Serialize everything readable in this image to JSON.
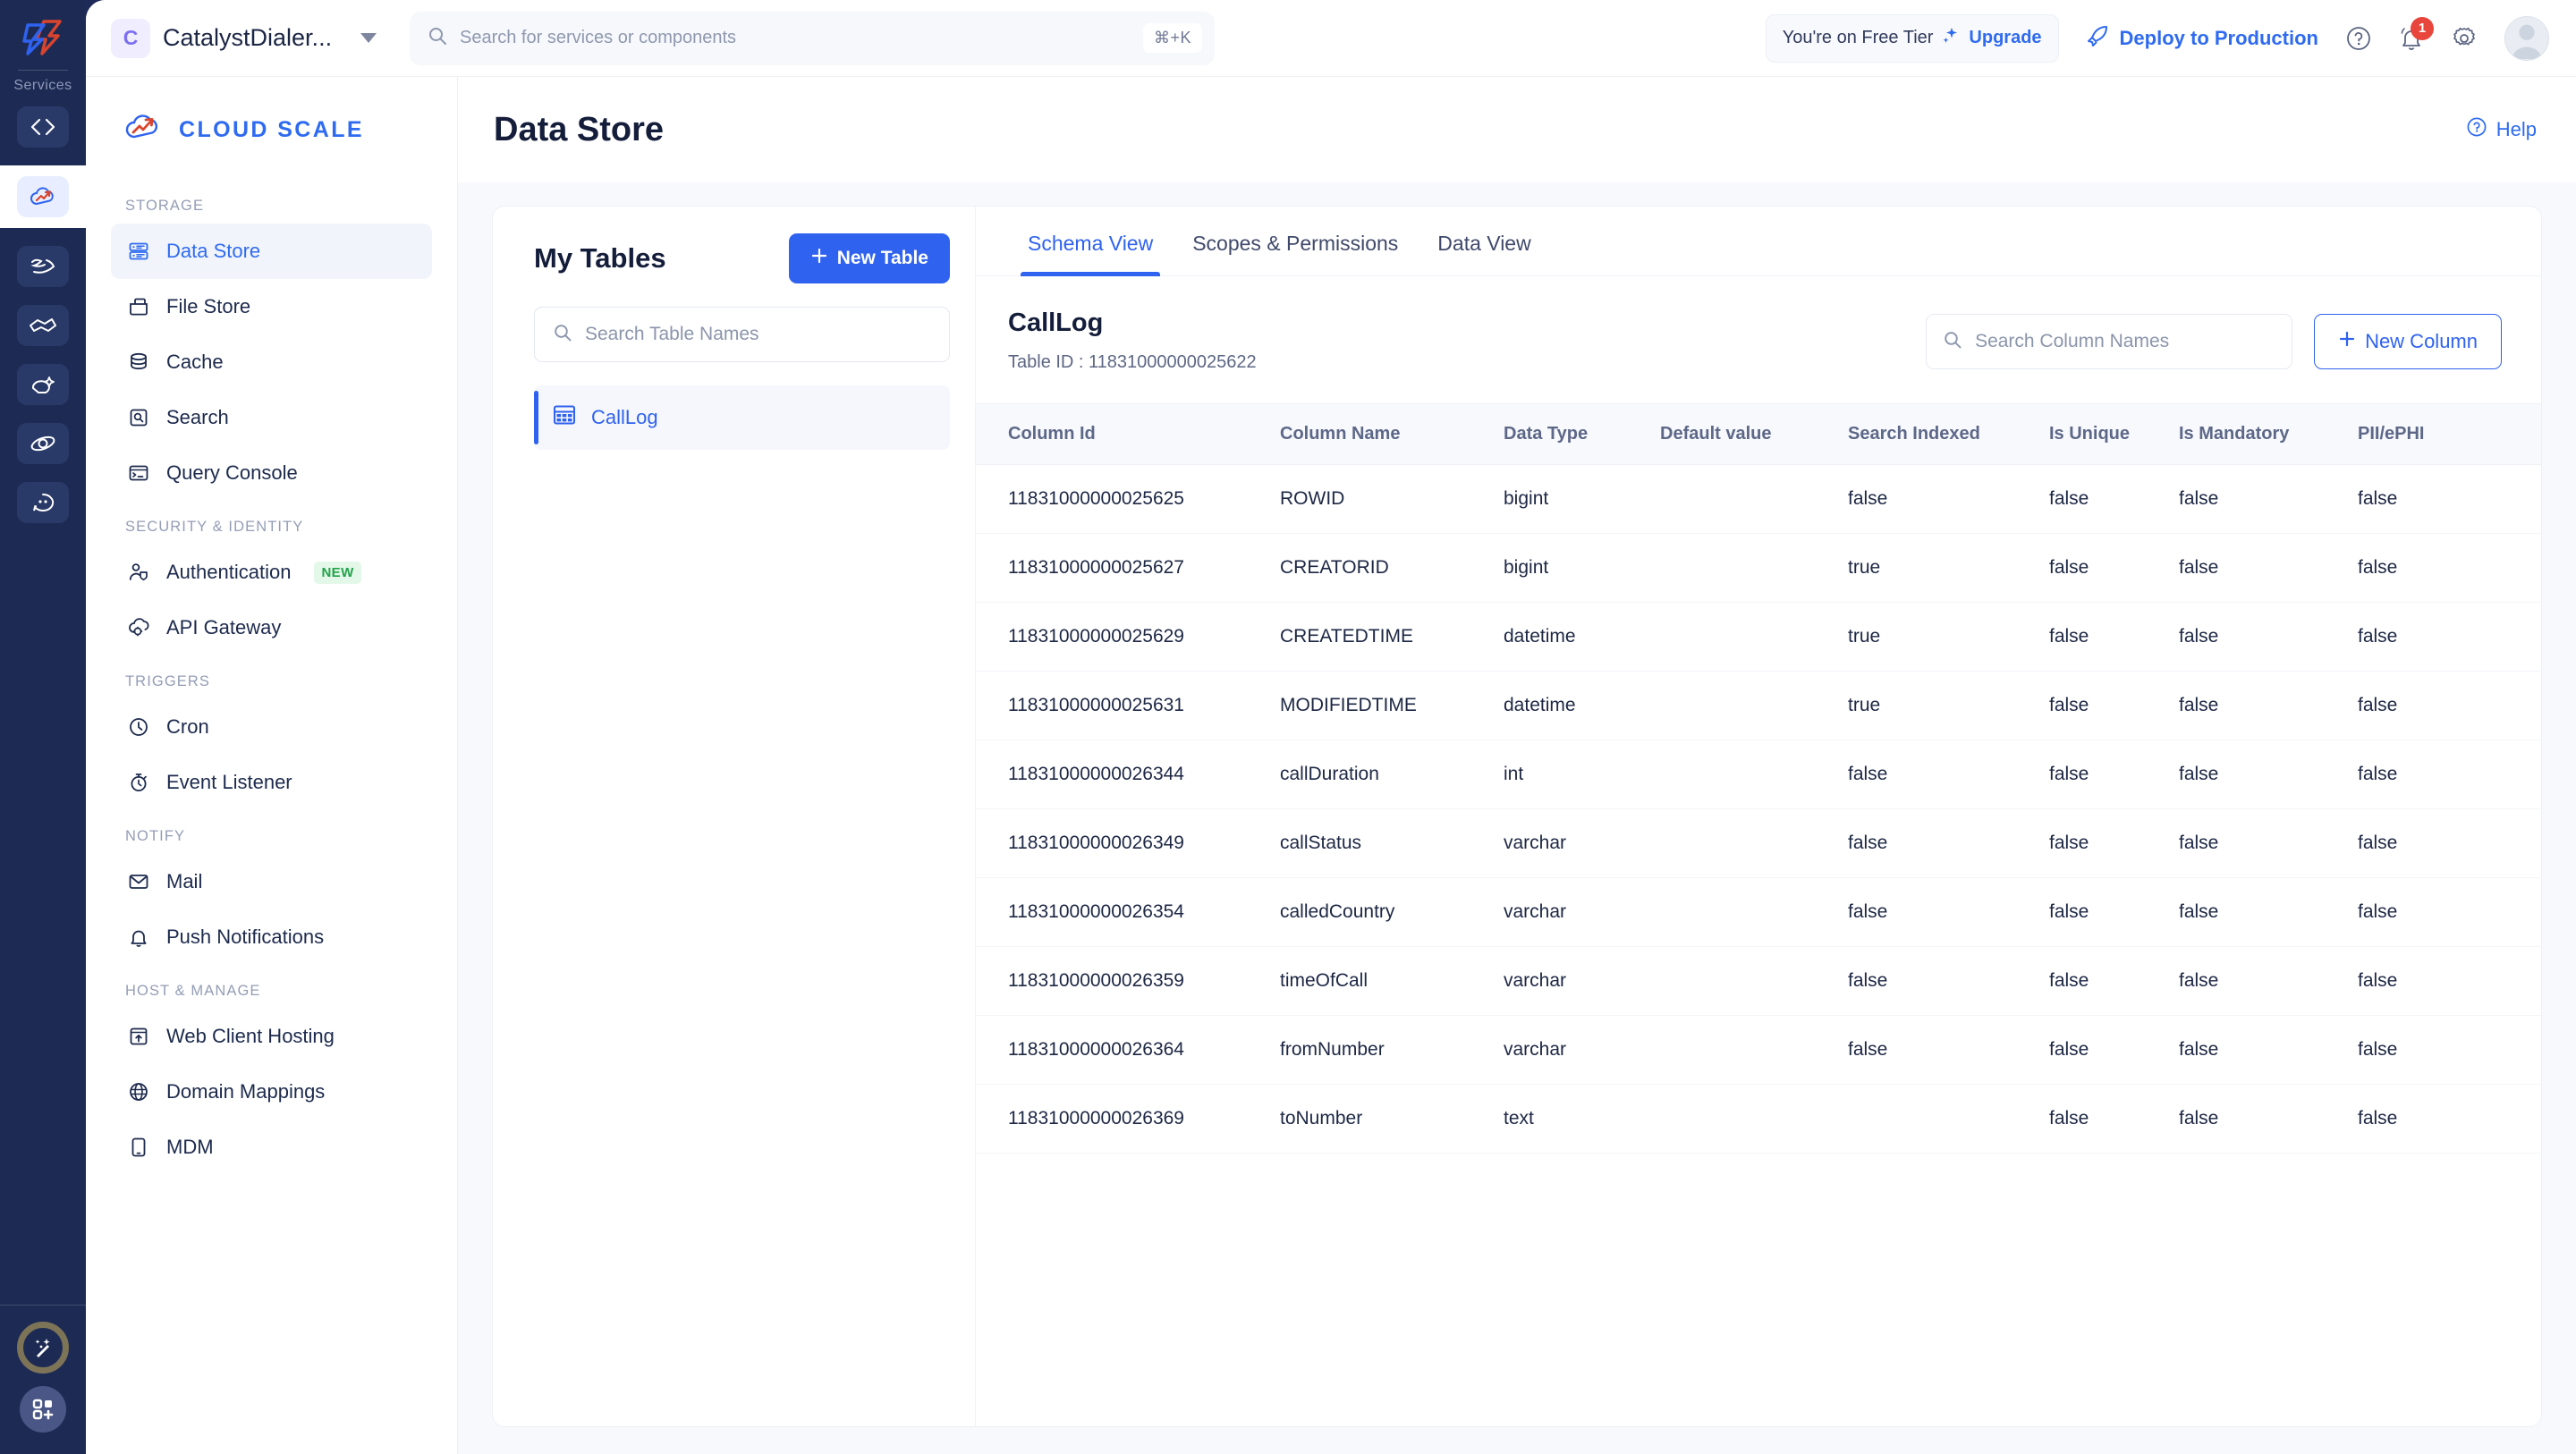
{
  "rail": {
    "logo_icon": "zoho-catalyst-logo-icon",
    "label": "Services",
    "items": [
      {
        "name": "code-icon",
        "active": false
      },
      {
        "name": "cloud-scale-icon",
        "active": true
      },
      {
        "name": "zia-icon",
        "active": false
      },
      {
        "name": "handshake-icon",
        "active": false
      },
      {
        "name": "quickml-icon",
        "active": false
      },
      {
        "name": "orbit-icon",
        "active": false
      },
      {
        "name": "circuit-icon",
        "active": false
      }
    ],
    "magic_icon": "magic-wand-icon",
    "apps_icon": "add-apps-icon"
  },
  "topbar": {
    "project_initial": "C",
    "project_name": "CatalystDialer...",
    "project_caret_icon": "chevron-down-icon",
    "search": {
      "icon": "search-icon",
      "placeholder": "Search for services or components",
      "value": "",
      "shortcut": "⌘+K"
    },
    "tier_text": "You're on Free Tier",
    "upgrade_label": "Upgrade",
    "upgrade_icon": "sparkle-icon",
    "deploy_label": "Deploy to Production",
    "deploy_icon": "rocket-icon",
    "help_icon": "help-circle-icon",
    "bell_icon": "bell-icon",
    "bell_count": "1",
    "settings_icon": "gear-icon",
    "avatar_icon": "avatar"
  },
  "sidebar": {
    "brand_icon": "cloud-scale-logo-icon",
    "brand": "CLOUD SCALE",
    "groups": [
      {
        "label": "STORAGE",
        "items": [
          {
            "label": "Data Store",
            "icon": "datastore-icon",
            "active": true,
            "badge": ""
          },
          {
            "label": "File Store",
            "icon": "filestore-icon",
            "active": false,
            "badge": ""
          },
          {
            "label": "Cache",
            "icon": "cache-icon",
            "active": false,
            "badge": ""
          },
          {
            "label": "Search",
            "icon": "search-box-icon",
            "active": false,
            "badge": ""
          },
          {
            "label": "Query Console",
            "icon": "console-icon",
            "active": false,
            "badge": ""
          }
        ]
      },
      {
        "label": "SECURITY & IDENTITY",
        "items": [
          {
            "label": "Authentication",
            "icon": "user-shield-icon",
            "active": false,
            "badge": "NEW"
          },
          {
            "label": "API Gateway",
            "icon": "api-gateway-icon",
            "active": false,
            "badge": ""
          }
        ]
      },
      {
        "label": "TRIGGERS",
        "items": [
          {
            "label": "Cron",
            "icon": "clock-icon",
            "active": false,
            "badge": ""
          },
          {
            "label": "Event Listener",
            "icon": "stopwatch-icon",
            "active": false,
            "badge": ""
          }
        ]
      },
      {
        "label": "NOTIFY",
        "items": [
          {
            "label": "Mail",
            "icon": "envelope-icon",
            "active": false,
            "badge": ""
          },
          {
            "label": "Push Notifications",
            "icon": "bell-icon",
            "active": false,
            "badge": ""
          }
        ]
      },
      {
        "label": "HOST & MANAGE",
        "items": [
          {
            "label": "Web Client Hosting",
            "icon": "upload-box-icon",
            "active": false,
            "badge": ""
          },
          {
            "label": "Domain Mappings",
            "icon": "globe-icon",
            "active": false,
            "badge": ""
          },
          {
            "label": "MDM",
            "icon": "mobile-icon",
            "active": false,
            "badge": ""
          }
        ]
      }
    ]
  },
  "main": {
    "page_title": "Data Store",
    "help_label": "Help",
    "help_icon": "help-circle-icon"
  },
  "tables_panel": {
    "title": "My Tables",
    "new_table_label": "New Table",
    "new_table_icon": "plus-icon",
    "search": {
      "icon": "search-icon",
      "placeholder": "Search Table Names",
      "value": ""
    },
    "items": [
      {
        "label": "CallLog",
        "icon": "grid-table-icon",
        "active": true
      }
    ]
  },
  "schema_panel": {
    "tabs": [
      {
        "label": "Schema View",
        "active": true
      },
      {
        "label": "Scopes & Permissions",
        "active": false
      },
      {
        "label": "Data View",
        "active": false
      }
    ],
    "table_name": "CallLog",
    "table_id_label": "Table ID : 11831000000025622",
    "column_search": {
      "icon": "search-icon",
      "placeholder": "Search Column Names",
      "value": ""
    },
    "new_column_label": "New Column",
    "new_column_icon": "plus-icon",
    "headers": [
      "Column Id",
      "Column Name",
      "Data Type",
      "Default value",
      "Search Indexed",
      "Is Unique",
      "Is Mandatory",
      "PII/ePHI"
    ],
    "rows": [
      [
        "11831000000025625",
        "ROWID",
        "bigint",
        "",
        "false",
        "false",
        "false",
        "false"
      ],
      [
        "11831000000025627",
        "CREATORID",
        "bigint",
        "",
        "true",
        "false",
        "false",
        "false"
      ],
      [
        "11831000000025629",
        "CREATEDTIME",
        "datetime",
        "",
        "true",
        "false",
        "false",
        "false"
      ],
      [
        "11831000000025631",
        "MODIFIEDTIME",
        "datetime",
        "",
        "true",
        "false",
        "false",
        "false"
      ],
      [
        "11831000000026344",
        "callDuration",
        "int",
        "",
        "false",
        "false",
        "false",
        "false"
      ],
      [
        "11831000000026349",
        "callStatus",
        "varchar",
        "",
        "false",
        "false",
        "false",
        "false"
      ],
      [
        "11831000000026354",
        "calledCountry",
        "varchar",
        "",
        "false",
        "false",
        "false",
        "false"
      ],
      [
        "11831000000026359",
        "timeOfCall",
        "varchar",
        "",
        "false",
        "false",
        "false",
        "false"
      ],
      [
        "11831000000026364",
        "fromNumber",
        "varchar",
        "",
        "false",
        "false",
        "false",
        "false"
      ],
      [
        "11831000000026369",
        "toNumber",
        "text",
        "",
        "",
        "false",
        "false",
        "false"
      ]
    ]
  },
  "colors": {
    "accent": "#2f62ef",
    "rail_bg": "#1d2b54",
    "badge_new": "#22a24a",
    "bell_badge": "#e8453c"
  }
}
